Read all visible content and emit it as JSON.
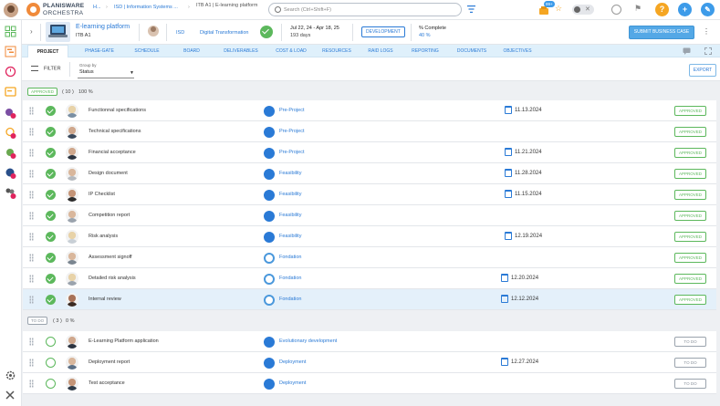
{
  "app": {
    "name": "PLANISWARE",
    "subname": "ORCHESTRA",
    "breadcrumb": [
      "H...",
      "ISD | Information Systems ...",
      "ITB A1 | E-learning platform"
    ],
    "search_placeholder": "Search (Ctrl+Shift+F)",
    "notification_count": "99+"
  },
  "project": {
    "title": "E-learning platform",
    "code": "ITB A1",
    "department": "ISD",
    "program": "Digital Transformation",
    "dates": "Jul 22, 24 - Apr 18, 25",
    "duration": "193 days",
    "stage": "DEVELOPMENT",
    "complete_label": "% Complete",
    "complete_value": "40 %",
    "submit_label": "SUBMIT BUSINESS CASE"
  },
  "tabs": [
    "PROJECT",
    "PHASE-GATE",
    "SCHEDULE",
    "BOARD",
    "DELIVERABLES",
    "COST & LOAD",
    "RESOURCES",
    "RAID LOGS",
    "REPORTING",
    "DOCUMENTS",
    "OBJECTIVES"
  ],
  "toolbar": {
    "filter_label": "FILTER",
    "group_by_label": "Group by",
    "group_by_value": "Status",
    "export_label": "EXPORT"
  },
  "groups": [
    {
      "badge": "APPROVED",
      "count": "( 10 )",
      "percent": "100 %",
      "rows": [
        {
          "name": "Functionnal specifications",
          "phase": "Pre-Project",
          "date": "11.13.2024",
          "status": "APPROVED",
          "selected": false
        },
        {
          "name": "Technical specifications",
          "phase": "Pre-Project",
          "date": "",
          "status": "APPROVED",
          "selected": false
        },
        {
          "name": "Financial acceptance",
          "phase": "Pre-Project",
          "date": "11.21.2024",
          "status": "APPROVED",
          "selected": false
        },
        {
          "name": "Design document",
          "phase": "Feasibility",
          "date": "11.28.2024",
          "status": "APPROVED",
          "selected": false
        },
        {
          "name": "IP Checklist",
          "phase": "Feasibility",
          "date": "11.15.2024",
          "status": "APPROVED",
          "selected": false
        },
        {
          "name": "Competition report",
          "phase": "Feasibility",
          "date": "",
          "status": "APPROVED",
          "selected": false
        },
        {
          "name": "Risk analysis",
          "phase": "Feasibility",
          "date": "12.19.2024",
          "status": "APPROVED",
          "selected": false
        },
        {
          "name": "Assessment signoff",
          "phase": "Fondation",
          "date": "",
          "status": "APPROVED",
          "selected": false
        },
        {
          "name": "Detailed risk analysis",
          "phase": "Fondation",
          "date": "12.20.2024",
          "status": "APPROVED",
          "selected": false
        },
        {
          "name": "Internal review",
          "phase": "Fondation",
          "date": "12.12.2024",
          "status": "APPROVED",
          "selected": true
        }
      ]
    },
    {
      "badge": "TO DO",
      "count": "( 3 )",
      "percent": "0 %",
      "rows": [
        {
          "name": "E-Learning Platform application",
          "phase": "Evolutionary development",
          "date": "",
          "status": "TO DO",
          "selected": false
        },
        {
          "name": "Deployment report",
          "phase": "Deployment",
          "date": "12.27.2024",
          "status": "TO DO",
          "selected": false
        },
        {
          "name": "Test acceptance",
          "phase": "Deployment",
          "date": "",
          "status": "TO DO",
          "selected": false
        }
      ]
    }
  ],
  "colors": {
    "accent": "#2a7ad6",
    "approved": "#5cb85c",
    "todo": "#9aa3ad",
    "tab_bg": "#dff0fb",
    "submit": "#54a8e6",
    "help": "#f5a623",
    "add": "#3d9be9"
  }
}
